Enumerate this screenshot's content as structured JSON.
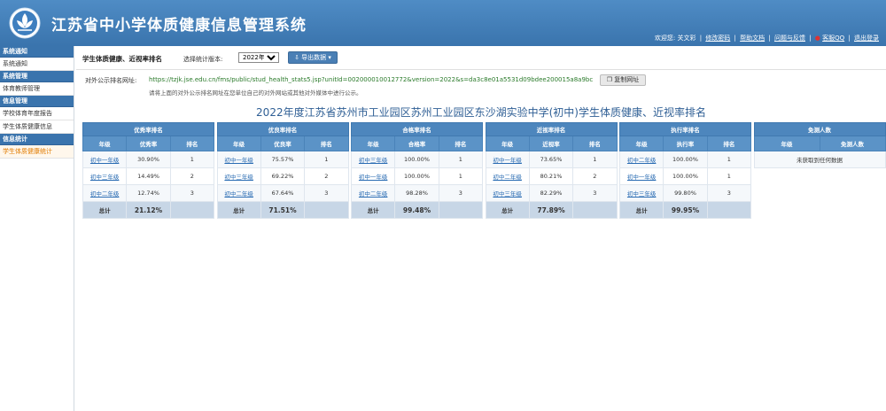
{
  "header": {
    "app_title": "江苏省中小学体质健康信息管理系统",
    "welcome": "欢迎您: 关文彩",
    "links": [
      "修改密码",
      "帮助文档",
      "问题与反馈",
      "客服QQ",
      "退出登录"
    ]
  },
  "sidebar": {
    "groups": [
      {
        "title": "系统通知",
        "items": [
          "系统通知"
        ]
      },
      {
        "title": "系统管理",
        "items": [
          "体育教师管理"
        ]
      },
      {
        "title": "信息管理",
        "items": [
          "学校体育年度报告",
          "学生体质健康信息"
        ]
      },
      {
        "title": "信息统计",
        "items": [
          "学生体质健康统计"
        ]
      }
    ],
    "active_item": "学生体质健康统计"
  },
  "toolbar": {
    "page_heading": "学生体质健康、近视率排名",
    "version_label": "选择统计版本:",
    "version_value": "2022年度",
    "export_label": "导出数据"
  },
  "public_url": {
    "label": "对外公示排名网址:",
    "value": "https://tzjk.jse.edu.cn/fms/public/stud_health_stats5.jsp?unitId=002000010012772&version=2022&s=da3c8e01a5531d09bdee200015a8a9bc",
    "copy_label": "复制网址",
    "hint": "请将上面的对外公示排名网址在您单位自己的对外网站或其他对外媒体中进行公示。"
  },
  "report_title": "2022年度江苏省苏州市工业园区苏州工业园区东沙湖实验中学(初中)学生体质健康、近视率排名",
  "tables": [
    {
      "caption": "优秀率排名",
      "headers": [
        "年级",
        "优秀率",
        "排名"
      ],
      "rows": [
        {
          "grade": "初中一年级",
          "value": "30.90%",
          "rank": "1"
        },
        {
          "grade": "初中三年级",
          "value": "14.49%",
          "rank": "2"
        },
        {
          "grade": "初中二年级",
          "value": "12.74%",
          "rank": "3"
        }
      ],
      "total_label": "总计",
      "total_value": "21.12%"
    },
    {
      "caption": "优良率排名",
      "headers": [
        "年级",
        "优良率",
        "排名"
      ],
      "rows": [
        {
          "grade": "初中一年级",
          "value": "75.57%",
          "rank": "1"
        },
        {
          "grade": "初中三年级",
          "value": "69.22%",
          "rank": "2"
        },
        {
          "grade": "初中二年级",
          "value": "67.64%",
          "rank": "3"
        }
      ],
      "total_label": "总计",
      "total_value": "71.51%"
    },
    {
      "caption": "合格率排名",
      "headers": [
        "年级",
        "合格率",
        "排名"
      ],
      "rows": [
        {
          "grade": "初中三年级",
          "value": "100.00%",
          "rank": "1"
        },
        {
          "grade": "初中一年级",
          "value": "100.00%",
          "rank": "1"
        },
        {
          "grade": "初中二年级",
          "value": "98.28%",
          "rank": "3"
        }
      ],
      "total_label": "总计",
      "total_value": "99.48%"
    },
    {
      "caption": "近视率排名",
      "headers": [
        "年级",
        "近视率",
        "排名"
      ],
      "rows": [
        {
          "grade": "初中一年级",
          "value": "73.65%",
          "rank": "1"
        },
        {
          "grade": "初中二年级",
          "value": "80.21%",
          "rank": "2"
        },
        {
          "grade": "初中三年级",
          "value": "82.29%",
          "rank": "3"
        }
      ],
      "total_label": "总计",
      "total_value": "77.89%"
    },
    {
      "caption": "执行率排名",
      "headers": [
        "年级",
        "执行率",
        "排名"
      ],
      "rows": [
        {
          "grade": "初中二年级",
          "value": "100.00%",
          "rank": "1"
        },
        {
          "grade": "初中一年级",
          "value": "100.00%",
          "rank": "1"
        },
        {
          "grade": "初中三年级",
          "value": "99.80%",
          "rank": "3"
        }
      ],
      "total_label": "总计",
      "total_value": "99.95%"
    }
  ],
  "exempt_table": {
    "caption": "免测人数",
    "headers": [
      "年级",
      "免测人数"
    ],
    "empty_text": "未获取到任何数据"
  }
}
